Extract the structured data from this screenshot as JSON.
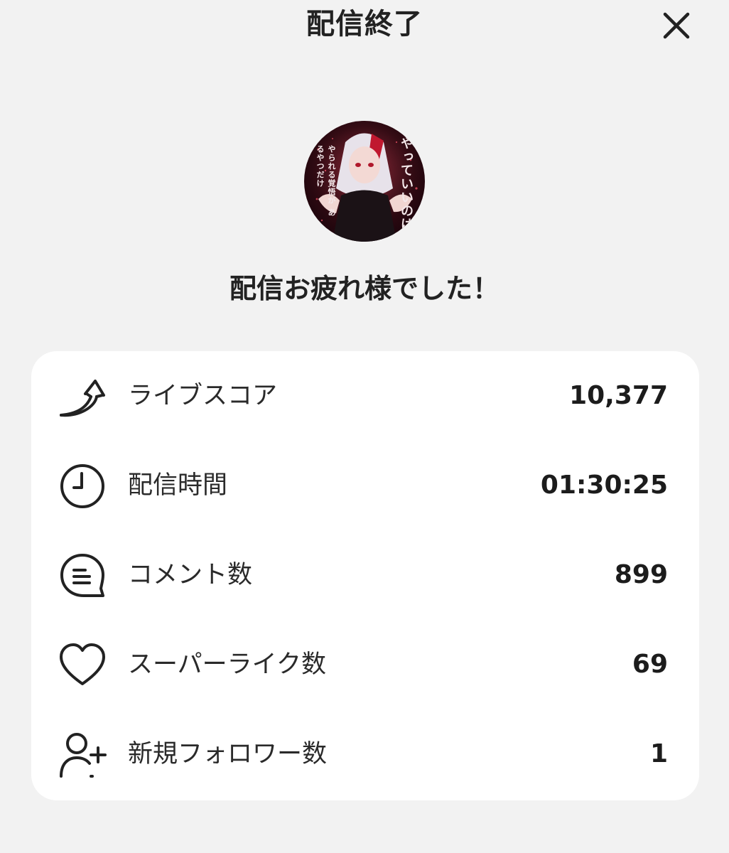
{
  "header": {
    "title": "配信終了",
    "close_icon": "close-icon"
  },
  "avatar": {
    "caption_right": "やっていいのは",
    "caption_left": "やられる覚悟が あるやつだけ"
  },
  "farewell_message": "配信お疲れ様でした！",
  "stats": [
    {
      "icon": "trending-up-arrow-icon",
      "label": "ライブスコア",
      "value": "10,377"
    },
    {
      "icon": "clock-icon",
      "label": "配信時間",
      "value": "01:30:25"
    },
    {
      "icon": "comment-bubble-icon",
      "label": "コメント数",
      "value": "899"
    },
    {
      "icon": "heart-icon",
      "label": "スーパーライク数",
      "value": "69"
    },
    {
      "icon": "add-user-icon",
      "label": "新規フォロワー数",
      "value": "1"
    }
  ],
  "colors": {
    "background": "#f2f2f2",
    "card": "#ffffff",
    "text": "#222222",
    "avatar_accent": "#8b1e2d"
  }
}
